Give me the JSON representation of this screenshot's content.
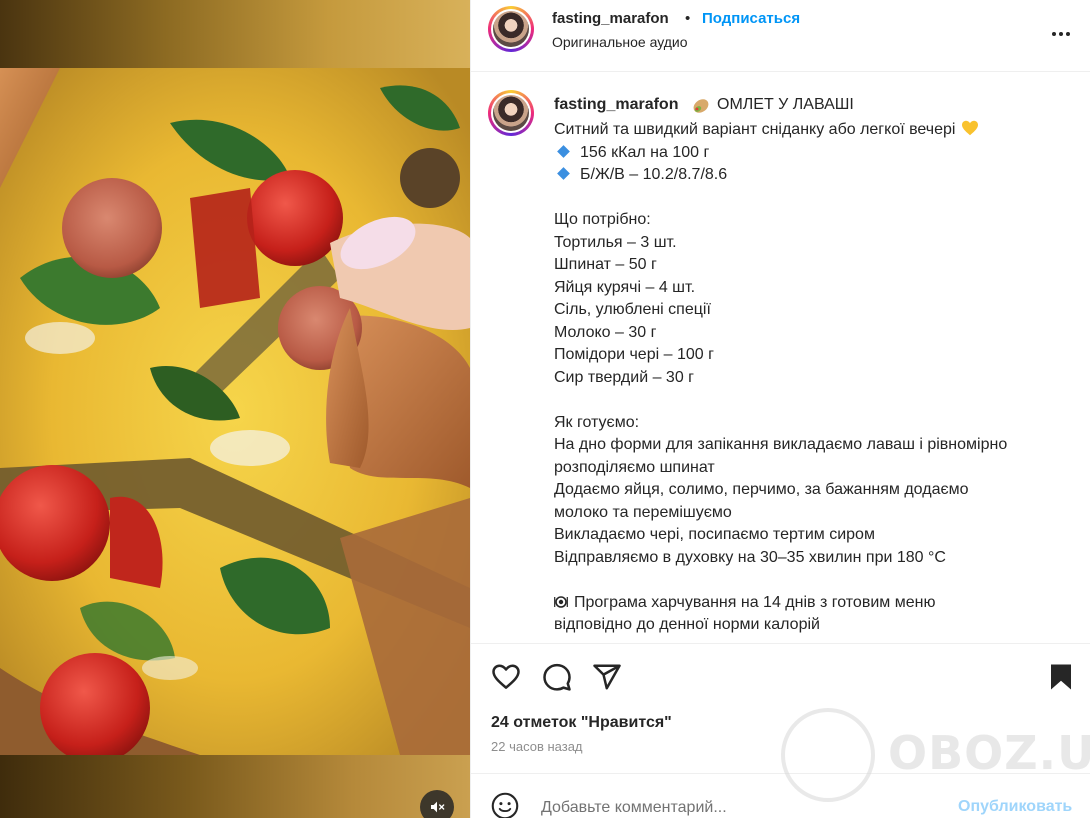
{
  "post": {
    "username": "fasting_marafon",
    "separator": "•",
    "follow_label": "Подписаться",
    "audio_label": "Оригинальное аудио",
    "more_icon": "more-horizontal-icon"
  },
  "caption": {
    "username": "fasting_marafon",
    "title": "ОМЛЕТ У ЛАВАШІ",
    "intro": "Ситний та швидкий варіант сніданку або легкої вечері",
    "stat_lines": [
      "156 кКал на 100 г",
      "Б/Ж/В – 10.2/8.7/8.6"
    ],
    "ingredients_heading": "Що потрібно:",
    "ingredients": [
      "Тортилья – 3 шт.",
      "Шпинат – 50 г",
      "Яйця курячі – 4 шт.",
      "Сіль, улюблені спеції",
      "Молоко – 30 г",
      "Помідори чері – 100 г",
      "Сир твердий – 30 г"
    ],
    "steps_heading": "Як готуємо:",
    "steps": [
      "На дно форми для запікання викладаємо лаваш і рівномірно",
      "розподіляємо шпинат",
      "Додаємо яйця, солимо, перчимо, за бажанням додаємо",
      "молоко та перемішуємо",
      "Викладаємо чері, посипаємо тертим сиром",
      "Відправляємо в духовку на 30–35 хвилин при 180 °C"
    ],
    "program_lines": [
      "Програма харчування на 14 днів з готовим меню",
      "відповідно до денної норми калорій"
    ]
  },
  "engagement": {
    "likes_text": "24 отметок \"Нравится\"",
    "time_ago": "22 часов назад"
  },
  "comment": {
    "placeholder": "Добавьте комментарий...",
    "publish_label": "Опубликовать"
  },
  "watermark": {
    "text": "OBOZ.UA"
  },
  "colors": {
    "link_blue": "#0095f6",
    "publish_disabled": "#9fd5fb",
    "text": "#262626",
    "secondary_text": "#8e8e8e"
  }
}
